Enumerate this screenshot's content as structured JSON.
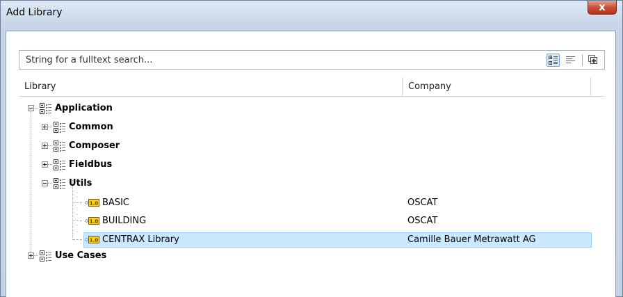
{
  "window": {
    "title": "Add Library",
    "close_glyph": "x"
  },
  "search": {
    "placeholder": "String for a fulltext search...",
    "toolbar": [
      {
        "icon": "category-view-icon",
        "active": true
      },
      {
        "icon": "list-view-icon",
        "active": false
      },
      {
        "icon": "details-view-icon",
        "active": false
      }
    ]
  },
  "columns": {
    "library": "Library",
    "company": "Company"
  },
  "tree": [
    {
      "label": "Application",
      "company": "",
      "type": "category",
      "bold": true,
      "expanded": true,
      "selected": false
    },
    {
      "label": "Common",
      "company": "",
      "type": "category",
      "bold": true,
      "expanded": false,
      "selected": false
    },
    {
      "label": "Composer",
      "company": "",
      "type": "category",
      "bold": true,
      "expanded": false,
      "selected": false
    },
    {
      "label": "Fieldbus",
      "company": "",
      "type": "category",
      "bold": true,
      "expanded": false,
      "selected": false
    },
    {
      "label": "Utils",
      "company": "",
      "type": "category",
      "bold": true,
      "expanded": true,
      "selected": false
    },
    {
      "label": "BASIC",
      "company": "OSCAT",
      "type": "library",
      "bold": false,
      "selected": false
    },
    {
      "label": "BUILDING",
      "company": "OSCAT",
      "type": "library",
      "bold": false,
      "selected": false
    },
    {
      "label": "CENTRAX Library",
      "company": "Camille Bauer Metrawatt AG",
      "type": "library",
      "bold": false,
      "selected": true
    },
    {
      "label": "Use Cases",
      "company": "",
      "type": "category",
      "bold": true,
      "expanded": false,
      "selected": false
    }
  ],
  "colors": {
    "selection_fill": "#cce8ff",
    "selection_border": "#99d1ff",
    "close_button": "#c95038",
    "library_badge": "#f4d21e"
  },
  "library_badge_text": "1.0"
}
